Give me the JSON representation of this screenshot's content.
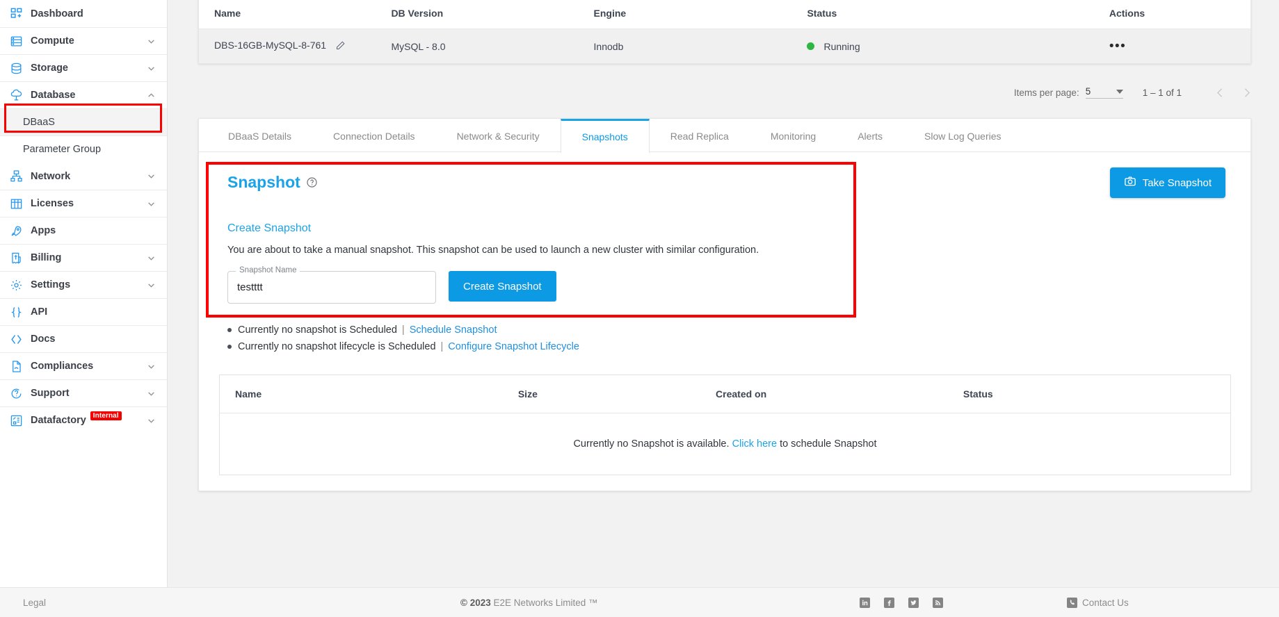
{
  "sidebar": {
    "items": [
      {
        "label": "Dashboard",
        "icon": "dashboard-icon",
        "expandable": false
      },
      {
        "label": "Compute",
        "icon": "server-icon",
        "expandable": true,
        "state": "collapsed"
      },
      {
        "label": "Storage",
        "icon": "database-stack-icon",
        "expandable": true,
        "state": "collapsed"
      },
      {
        "label": "Database",
        "icon": "cloud-database-icon",
        "expandable": true,
        "state": "expanded"
      },
      {
        "label": "Network",
        "icon": "network-icon",
        "expandable": true,
        "state": "collapsed"
      },
      {
        "label": "Licenses",
        "icon": "grid-license-icon",
        "expandable": true,
        "state": "collapsed"
      },
      {
        "label": "Apps",
        "icon": "rocket-icon",
        "expandable": false
      },
      {
        "label": "Billing",
        "icon": "invoice-dollar-icon",
        "expandable": true,
        "state": "collapsed"
      },
      {
        "label": "Settings",
        "icon": "gear-icon",
        "expandable": true,
        "state": "collapsed"
      },
      {
        "label": "API",
        "icon": "braces-icon",
        "expandable": false
      },
      {
        "label": "Docs",
        "icon": "angle-brackets-icon",
        "expandable": false
      },
      {
        "label": "Compliances",
        "icon": "document-icon",
        "expandable": true,
        "state": "collapsed"
      },
      {
        "label": "Support",
        "icon": "support-chat-icon",
        "expandable": true,
        "state": "collapsed"
      },
      {
        "label": "Datafactory",
        "icon": "datafactory-icon",
        "expandable": true,
        "state": "collapsed",
        "badge": "Internal"
      }
    ],
    "database_children": [
      {
        "label": "DBaaS",
        "selected": true
      },
      {
        "label": "Parameter Group",
        "selected": false
      }
    ]
  },
  "cluster_table": {
    "columns": [
      "Name",
      "DB Version",
      "Engine",
      "Status",
      "Actions"
    ],
    "rows": [
      {
        "name": "DBS-16GB-MySQL-8-761",
        "db_version": "MySQL - 8.0",
        "engine": "Innodb",
        "status": "Running",
        "status_color": "#2db742",
        "actions": "•••"
      }
    ]
  },
  "paginator": {
    "items_per_page_label": "Items per page:",
    "items_per_page_value": "5",
    "range": "1 – 1 of 1",
    "prev_icon": "chevron-left-icon",
    "next_icon": "chevron-right-icon"
  },
  "tabs": [
    {
      "label": "DBaaS Details",
      "active": false
    },
    {
      "label": "Connection Details",
      "active": false
    },
    {
      "label": "Network & Security",
      "active": false
    },
    {
      "label": "Snapshots",
      "active": true
    },
    {
      "label": "Read Replica",
      "active": false
    },
    {
      "label": "Monitoring",
      "active": false
    },
    {
      "label": "Alerts",
      "active": false
    },
    {
      "label": "Slow Log Queries",
      "active": false
    }
  ],
  "snapshot_panel": {
    "title": "Snapshot",
    "help_icon": "help-circle-icon",
    "create_heading": "Create Snapshot",
    "description": "You are about to take a manual snapshot. This snapshot can be used to launch a new cluster with similar configuration.",
    "field_label": "Snapshot Name",
    "field_value": "testttt",
    "field_placeholder": "Snapshot Name",
    "create_button": "Create Snapshot",
    "take_snapshot_button": "Take Snapshot",
    "take_snapshot_icon": "camera-icon",
    "accent_color": "#0d9ae4",
    "highlight_color": "#fe0000"
  },
  "schedule_lines": [
    {
      "text": "Currently no snapshot is Scheduled",
      "separator": "|",
      "link": "Schedule Snapshot"
    },
    {
      "text": "Currently no snapshot lifecycle is Scheduled",
      "separator": "|",
      "link": "Configure Snapshot Lifecycle"
    }
  ],
  "snapshot_table": {
    "columns": [
      "Name",
      "Size",
      "Created on",
      "Status"
    ],
    "empty_prefix": "Currently no Snapshot is available.",
    "empty_link": "Click here",
    "empty_suffix": "to schedule Snapshot"
  },
  "footer": {
    "legal": "Legal",
    "copyright_year": "© 2023",
    "copyright_name": "E2E Networks Limited ™",
    "socials": [
      {
        "name": "linkedin-icon",
        "glyph": "in"
      },
      {
        "name": "facebook-icon",
        "glyph": "f"
      },
      {
        "name": "twitter-icon",
        "glyph": "t"
      },
      {
        "name": "rss-icon",
        "glyph": "r"
      }
    ],
    "contact": "Contact Us",
    "contact_icon": "phone-icon"
  }
}
